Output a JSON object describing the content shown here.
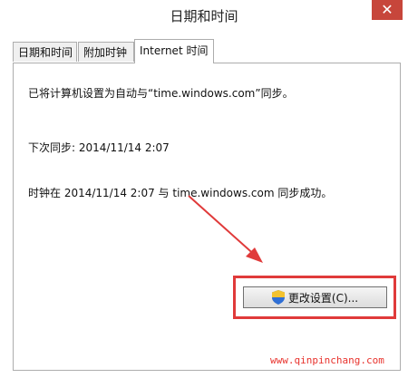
{
  "window": {
    "title": "日期和时间",
    "close_glyph": "✕"
  },
  "tabs": [
    {
      "label": "日期和时间",
      "selected": false
    },
    {
      "label": "附加时钟",
      "selected": false
    },
    {
      "label": "Internet 时间",
      "selected": true
    }
  ],
  "internet_time": {
    "sync_status": "已将计算机设置为自动与“time.windows.com”同步。",
    "next_sync": "下次同步: 2014/11/14 2:07",
    "last_sync_result": "时钟在 2014/11/14 2:07 与 time.windows.com 同步成功。",
    "change_settings_label": "更改设置(C)...",
    "change_settings_icon": "uac-shield-icon"
  },
  "annotation": {
    "color": "#e03a3a"
  },
  "watermark": {
    "text": "www.qinpinchang.com",
    "color": "#e8332d"
  }
}
